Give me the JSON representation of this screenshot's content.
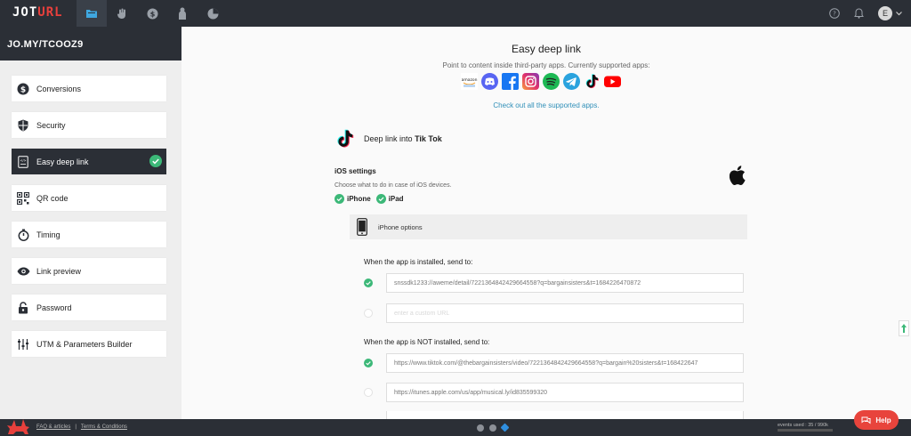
{
  "app": {
    "logo_left": "JOT",
    "logo_right": "URL"
  },
  "topnav": [
    {
      "name": "folder-icon",
      "active": true
    },
    {
      "name": "hand-icon",
      "active": false
    },
    {
      "name": "coin-icon",
      "active": false
    },
    {
      "name": "person-icon",
      "active": false
    },
    {
      "name": "pie-chart-icon",
      "active": false
    }
  ],
  "user": {
    "initial": "E"
  },
  "sidebar": {
    "link_title": "JO.MY/TCOOZ9",
    "items": [
      {
        "label": "Conversions",
        "icon": "dollar-icon",
        "active": false
      },
      {
        "label": "Security",
        "icon": "shield-icon",
        "active": false
      },
      {
        "label": "Easy deep link",
        "icon": "deeplink-icon",
        "active": true
      },
      {
        "label": "QR code",
        "icon": "qr-icon",
        "active": false
      },
      {
        "label": "Timing",
        "icon": "stopwatch-icon",
        "active": false
      },
      {
        "label": "Link preview",
        "icon": "eye-icon",
        "active": false
      },
      {
        "label": "Password",
        "icon": "lock-icon",
        "active": false
      },
      {
        "label": "UTM & Parameters Builder",
        "icon": "sliders-icon",
        "active": false
      }
    ]
  },
  "main": {
    "title": "Easy deep link",
    "subtitle": "Point to content inside third-party apps. Currently supported apps:",
    "apps": [
      "amazon-icon",
      "discord-icon",
      "facebook-icon",
      "instagram-icon",
      "spotify-icon",
      "telegram-icon",
      "tiktok-icon",
      "youtube-icon"
    ],
    "apps_amazon_text": "amazon",
    "supported_link": "Check out all the supported apps.",
    "deeplink_prefix": "Deep link into",
    "deeplink_app": "Tik Tok",
    "ios_title": "iOS settings",
    "ios_desc": "Choose what to do in case of iOS devices.",
    "device_iphone": "iPhone",
    "device_ipad": "iPad",
    "iphone_options": "iPhone options",
    "installed_label": "When the app is installed, send to:",
    "installed_url": "snssdk1233://aweme/detail/7221364842429664558?q=bargainsisters&t=1684226470872",
    "installed_placeholder": "enter a custom URL",
    "not_installed_label": "When the app is NOT installed, send to:",
    "not_installed_url": "https://www.tiktok.com/@thebargainsisters/video/7221364842429664558?q=bargain%20sisters&t=168422647",
    "store_url": "https://itunes.apple.com/us/app/musical.ly/id835599320"
  },
  "footer": {
    "faq": "FAQ & articles",
    "sep": "|",
    "terms": "Terms & Conditions",
    "events": "events used : 35 / 990k",
    "help": "Help"
  },
  "colors": {
    "accent": "#2f8fb8",
    "check": "#3cb878",
    "dark": "#2b2f36",
    "help": "#e8443c"
  }
}
